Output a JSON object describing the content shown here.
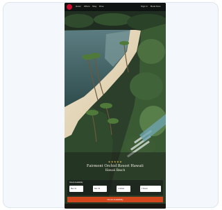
{
  "nav": {
    "links": [
      "Hotel",
      "Offers",
      "Stay",
      "Dine"
    ],
    "right_links": [
      "Sign In",
      "Book Now"
    ]
  },
  "hero": {
    "stars": "★★★★★",
    "title": "Fairmont Orchid Resort Hawaii",
    "subtitle": "Hawaii Beach"
  },
  "booking": {
    "heading": "Check Availability",
    "fields": [
      {
        "label": "Check-in",
        "value": "Mar 12"
      },
      {
        "label": "Check-out",
        "value": "Mar 15"
      },
      {
        "label": "Guests",
        "value": "2 Adults"
      },
      {
        "label": "Rooms",
        "value": "1 Room"
      }
    ],
    "button_label": "Check Availability"
  },
  "colors": {
    "accent": "#c8102e",
    "cta": "#d2461e"
  },
  "icons": {
    "logo": "brand-logo-icon"
  }
}
